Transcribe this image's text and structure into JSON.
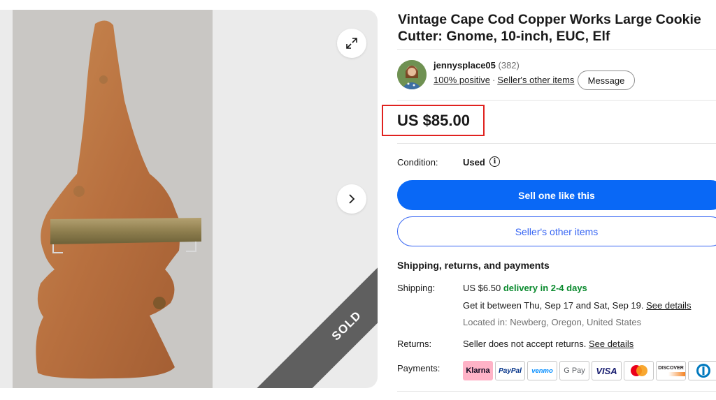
{
  "listing": {
    "title": "Vintage Cape Cod Copper Works Large Cookie Cutter: Gnome, 10-inch, EUC, Elf",
    "sold_label": "SOLD",
    "price": "US $85.00"
  },
  "seller": {
    "name": "jennysplace05",
    "score": "(382)",
    "feedback": "100% positive",
    "separator": "·",
    "other_items_link": "Seller's other items",
    "message_button": "Message"
  },
  "condition": {
    "label": "Condition:",
    "value": "Used",
    "info_icon": "info-icon"
  },
  "actions": {
    "primary": "Sell one like this",
    "secondary": "Seller's other items"
  },
  "shipping": {
    "heading": "Shipping, returns, and payments",
    "shipping_label": "Shipping:",
    "shipping_cost": "US $6.50",
    "delivery": "delivery in 2-4 days",
    "estimate": "Get it between Thu, Sep 17 and Sat, Sep 19.",
    "see_details": "See details",
    "location": "Located in: Newberg, Oregon, United States",
    "returns_label": "Returns:",
    "returns_text": "Seller does not accept returns.",
    "returns_details": "See details",
    "payments_label": "Payments:"
  },
  "payments": {
    "klarna": "Klarna",
    "paypal": "PayPal",
    "venmo": "venmo",
    "gpay": "G Pay",
    "visa": "VISA",
    "discover": "DISCOVER"
  },
  "colors": {
    "primary_button": "#0968f6",
    "link_blue": "#3665f3",
    "price_highlight": "#e0221f",
    "delivery_green": "#0a8a2e"
  }
}
